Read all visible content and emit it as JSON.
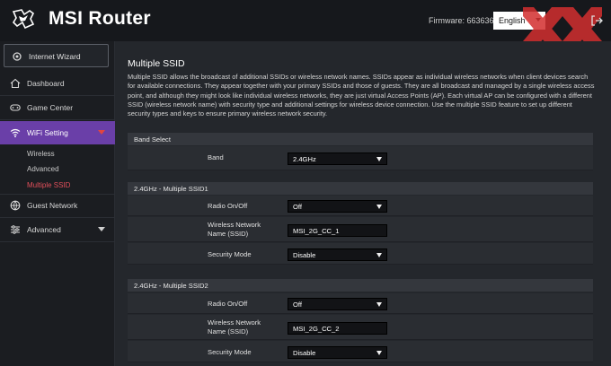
{
  "header": {
    "brand": "MSI Router",
    "firmware": "Firmware: 663636",
    "language": "English",
    "colors": {
      "bar": "#16181c",
      "brand_text": "#ffffff",
      "watermark": "#d32f2f"
    }
  },
  "sidebar": {
    "wizard_label": "Internet Wizard",
    "dashboard": "Dashboard",
    "game_center": "Game Center",
    "wifi_setting": "WiFi Setting",
    "subs": [
      "Wireless",
      "Advanced",
      "Multiple SSID"
    ],
    "guest_network": "Guest Network",
    "advanced": "Advanced",
    "colors": {
      "active_bg": "#6a3fa8",
      "active_sub": "#e14f5a"
    }
  },
  "main": {
    "title": "Multiple SSID",
    "description": "Multiple SSID allows the broadcast of additional SSIDs or wireless network names. SSIDs appear as individual wireless networks when client devices search for available connections. They appear together with your primary SSIDs and those of guests. They are all broadcast and managed by a single wireless access point, and although they might look like individual wireless networks, they are just virtual Access Points (AP). Each virtual AP can be configured with a different SSID (wireless network name) with security type and additional settings for wireless device connection. Use the multiple SSID feature to set up different security types and keys to ensure primary wireless network security.",
    "band_select": {
      "heading": "Band Select",
      "band_label": "Band",
      "band_value": "2.4GHz"
    },
    "ssid1": {
      "heading": "2.4GHz - Multiple SSID1",
      "radio_label": "Radio On/Off",
      "radio_value": "Off",
      "name_label_1": "Wireless Network",
      "name_label_2": "Name (SSID)",
      "name_value": "MSI_2G_CC_1",
      "security_label": "Security Mode",
      "security_value": "Disable"
    },
    "ssid2": {
      "heading": "2.4GHz - Multiple SSID2",
      "radio_label": "Radio On/Off",
      "radio_value": "Off",
      "name_label_1": "Wireless Network",
      "name_label_2": "Name (SSID)",
      "name_value": "MSI_2G_CC_2",
      "security_label": "Security Mode",
      "security_value": "Disable"
    }
  }
}
